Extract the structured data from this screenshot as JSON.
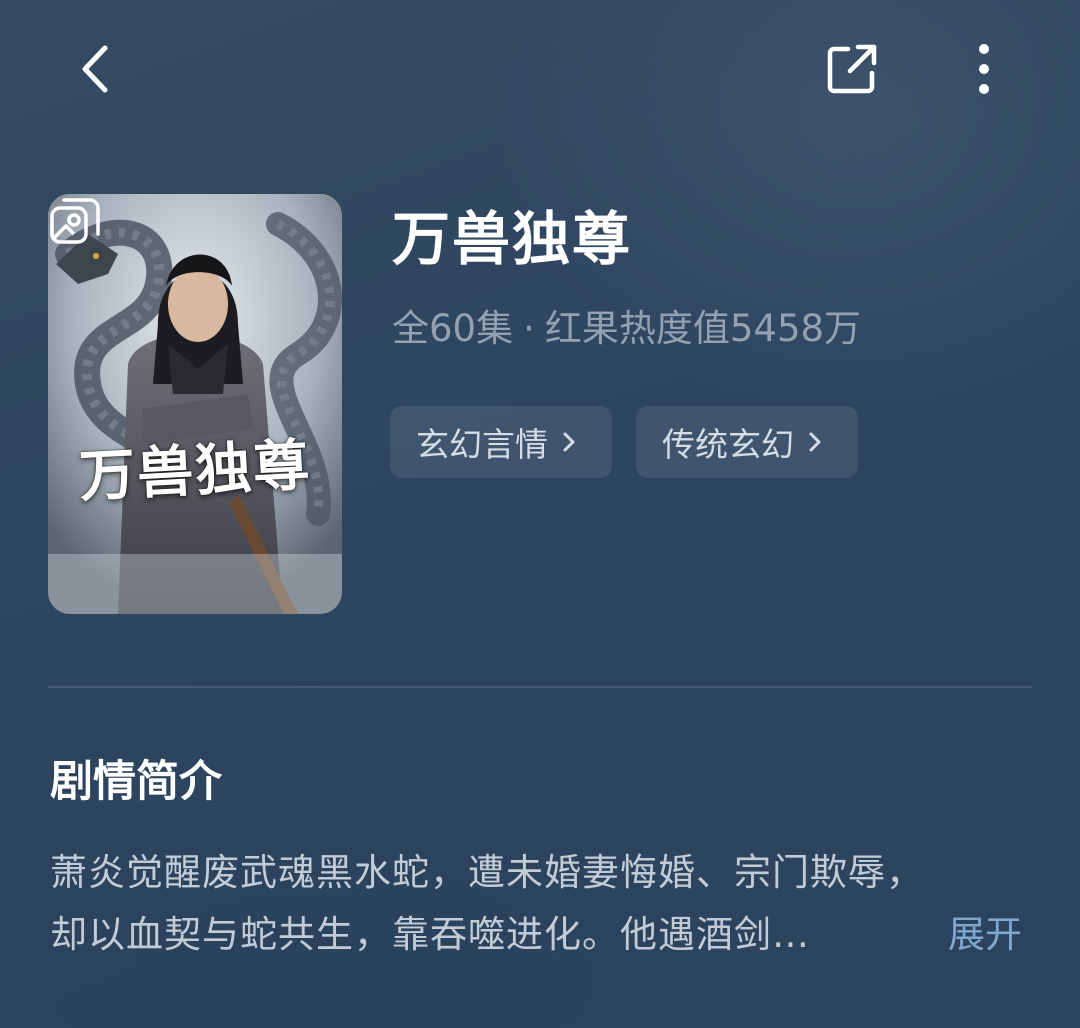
{
  "header": {
    "back_icon": "chevron-left-icon",
    "share_icon": "share-external-icon",
    "more_icon": "more-vertical-icon"
  },
  "drama": {
    "cover_title": "万兽独尊",
    "title": "万兽独尊",
    "episodes": "全60集",
    "separator": "·",
    "heat": "红果热度值5458万",
    "tags": [
      {
        "label": "玄幻言情"
      },
      {
        "label": "传统玄幻"
      }
    ],
    "gallery_icon": "image-gallery-icon"
  },
  "synopsis": {
    "heading": "剧情简介",
    "line1": "萧炎觉醒废武魂黑水蛇，遭未婚妻悔婚、宗门欺辱，",
    "line2": "却以血契与蛇共生，靠吞噬进化。他遇酒剑…",
    "expand_label": "展开"
  },
  "colors": {
    "background": "#2f4660",
    "meta_text": "#93a1b1",
    "expand_link": "#7fa7cf",
    "tag_bg": "rgba(255,255,255,0.09)"
  }
}
